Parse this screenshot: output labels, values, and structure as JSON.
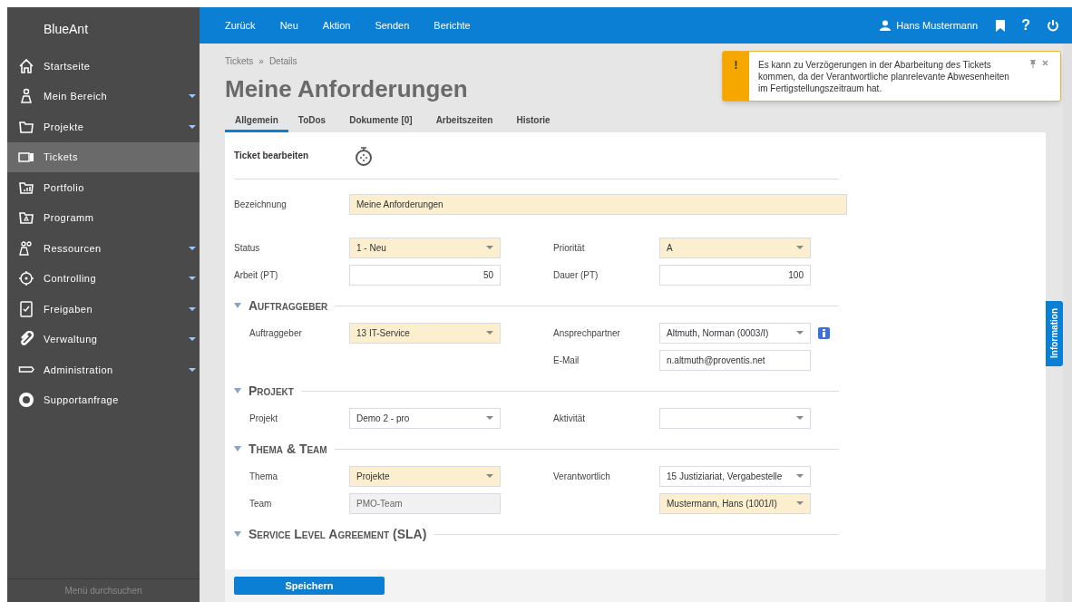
{
  "sidebar": {
    "logo": "BlueAnt",
    "items": [
      {
        "label": "Startseite",
        "kind": "home",
        "has_submenu": false,
        "selected": false
      },
      {
        "label": "Mein Bereich",
        "kind": "person",
        "has_submenu": true,
        "selected": false
      },
      {
        "label": "Projekte",
        "kind": "folder",
        "has_submenu": true,
        "selected": false
      },
      {
        "label": "Tickets",
        "kind": "ticket",
        "has_submenu": false,
        "selected": true
      },
      {
        "label": "Portfolio",
        "kind": "portfolio",
        "has_submenu": false,
        "selected": false
      },
      {
        "label": "Programm",
        "kind": "program",
        "has_submenu": false,
        "selected": false
      },
      {
        "label": "Ressourcen",
        "kind": "people",
        "has_submenu": true,
        "selected": false
      },
      {
        "label": "Controlling",
        "kind": "target",
        "has_submenu": true,
        "selected": false
      },
      {
        "label": "Freigaben",
        "kind": "check",
        "has_submenu": true,
        "selected": false
      },
      {
        "label": "Verwaltung",
        "kind": "clip",
        "has_submenu": true,
        "selected": false
      },
      {
        "label": "Administration",
        "kind": "key",
        "has_submenu": true,
        "selected": false
      },
      {
        "label": "Supportanfrage",
        "kind": "ring",
        "has_submenu": false,
        "selected": false
      }
    ],
    "search_placeholder": "Menü durchsuchen"
  },
  "topbar": {
    "nav": [
      "Zurück",
      "Neu",
      "Aktion",
      "Senden",
      "Berichte"
    ],
    "user": "Hans Mustermann",
    "help": "?"
  },
  "breadcrumb": [
    "Tickets",
    "»",
    "Details"
  ],
  "title": "Meine Anforderungen",
  "tabs": [
    {
      "label": "Allgemein",
      "selected": true
    },
    {
      "label": "ToDos",
      "selected": false
    },
    {
      "label": "Dokumente [0]",
      "selected": false
    },
    {
      "label": "Arbeitszeiten",
      "selected": false
    },
    {
      "label": "Historie",
      "selected": false
    }
  ],
  "form": {
    "header": "Ticket bearbeiten",
    "general": [
      {
        "full": {
          "label": "Bezeichnung",
          "kind": "text",
          "value": "Meine Anforderungen",
          "required": true
        }
      },
      {
        "left": {
          "label": "Status",
          "kind": "select",
          "value": "1 - Neu",
          "required": true
        },
        "right": {
          "label": "Priorität",
          "kind": "select",
          "value": "A",
          "required": true
        }
      },
      {
        "left": {
          "label": "Arbeit (PT)",
          "kind": "number",
          "value": "50",
          "required": false
        },
        "right": {
          "label": "Dauer (PT)",
          "kind": "number",
          "value": "100",
          "required": false
        }
      }
    ],
    "sections": [
      {
        "title": "Auftraggeber",
        "expanded": true,
        "rows": [
          {
            "left": {
              "label": "Auftraggeber",
              "kind": "select",
              "value": "13 IT-Service",
              "required": true
            },
            "right": {
              "label": "Ansprechpartner",
              "kind": "select",
              "value": "Altmuth, Norman (0003/I)",
              "required": false,
              "info_button": true
            }
          },
          {
            "right": {
              "label": "E-Mail",
              "kind": "text",
              "value": "n.altmuth@proventis.net",
              "required": false
            }
          }
        ]
      },
      {
        "title": "Projekt",
        "expanded": true,
        "rows": [
          {
            "left": {
              "label": "Projekt",
              "kind": "select",
              "value": "Demo 2 - pro",
              "required": false
            },
            "right": {
              "label": "Aktivität",
              "kind": "select",
              "required": false
            }
          }
        ]
      },
      {
        "title": "Thema & Team",
        "expanded": true,
        "rows": [
          {
            "left": {
              "label": "Thema",
              "kind": "select",
              "value": "Projekte",
              "required": true
            },
            "right": {
              "label": "Verantwortlich",
              "kind": "select",
              "value": "15 Justiziariat, Vergabestelle",
              "required": false
            }
          },
          {
            "left": {
              "label": "Team",
              "kind": "text",
              "value": "PMO-Team",
              "disabled": true
            },
            "right": {
              "kind": "select",
              "value": "Mustermann, Hans (1001/I)",
              "required": true
            }
          }
        ]
      },
      {
        "title": "Service Level Agreement (SLA)",
        "expanded": true
      }
    ],
    "save_button": "Speichern"
  },
  "toast": {
    "symbol": "!",
    "message": "Es kann zu Verzögerungen in der Abarbeitung des Tickets kommen, da der Verantwortliche planrelevante Abwesenheiten im Fertigstellungszeitraum hat."
  },
  "side_tab": "Information"
}
